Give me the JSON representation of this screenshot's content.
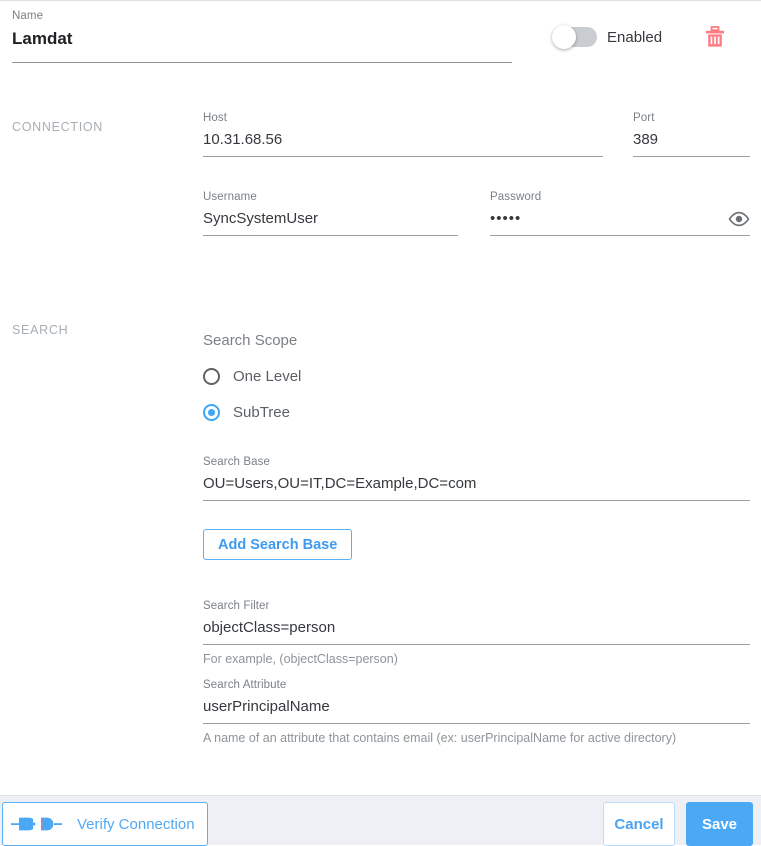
{
  "name_field": {
    "label": "Name",
    "value": "Lamdat",
    "placeholder": "Name"
  },
  "enabled_toggle": {
    "label": "Enabled",
    "state": "off"
  },
  "delete_icon": {
    "name": "trash-icon",
    "color": "#fc7b83"
  },
  "sections": {
    "connection": "CONNECTION",
    "search": "SEARCH"
  },
  "connection": {
    "host": {
      "label": "Host",
      "value": "10.31.68.56",
      "placeholder": "Host"
    },
    "port": {
      "label": "Port",
      "value": "389",
      "placeholder": "Port"
    },
    "username": {
      "label": "Username",
      "value": "SyncSystemUser",
      "placeholder": "Username"
    },
    "password": {
      "label": "Password",
      "value": "•••••",
      "placeholder": "Password",
      "masked": true,
      "reveal_icon": "eye-icon"
    }
  },
  "search": {
    "scope": {
      "title": "Search Scope",
      "options": [
        {
          "label": "One Level",
          "selected": false
        },
        {
          "label": "SubTree",
          "selected": true
        }
      ]
    },
    "search_base": {
      "label": "Search Base",
      "value": "OU=Users,OU=IT,DC=Example,DC=com",
      "placeholder": "Search Base"
    },
    "add_search_base_label": "Add Search Base",
    "search_filter": {
      "label": "Search Filter",
      "value": "objectClass=person",
      "placeholder": "Search Filter",
      "hint": "For example, (objectClass=person)"
    },
    "search_attribute": {
      "label": "Search Attribute",
      "value": "userPrincipalName",
      "placeholder": "Search Attribute",
      "hint": "A name of an attribute that contains email (ex: userPrincipalName for active directory)"
    }
  },
  "footer": {
    "verify_label": "Verify Connection",
    "verify_icon": "plug-connection-icon",
    "cancel_label": "Cancel",
    "save_label": "Save"
  },
  "colors": {
    "accent_blue": "#4aa8f5",
    "danger_red": "#fc7b83",
    "footer_bg": "#eef0f5",
    "label_grey": "#7b8086"
  }
}
